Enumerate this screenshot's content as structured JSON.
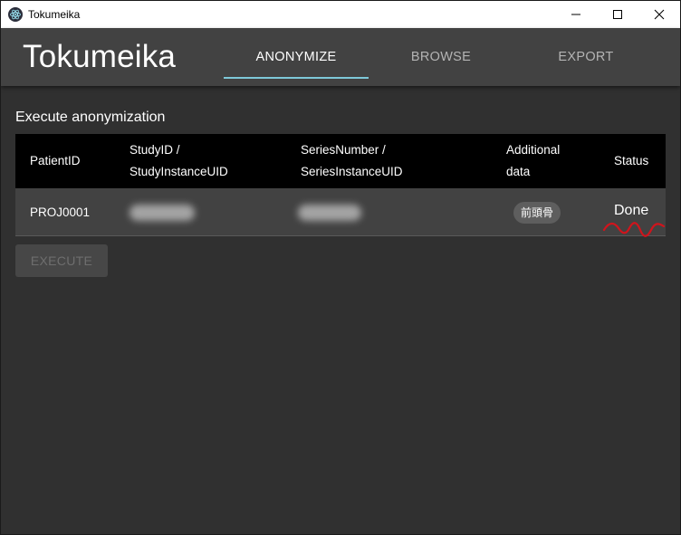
{
  "window": {
    "title": "Tokumeika"
  },
  "appbar": {
    "brand": "Tokumeika",
    "tabs": [
      {
        "label": "ANONYMIZE",
        "active": true
      },
      {
        "label": "BROWSE",
        "active": false
      },
      {
        "label": "EXPORT",
        "active": false
      }
    ],
    "indicator_color": "#7ec8d8"
  },
  "main": {
    "section_title": "Execute anonymization",
    "table": {
      "headers": {
        "patient_id": "PatientID",
        "study_line1": "StudyID /",
        "study_line2": "StudyInstanceUID",
        "series_line1": "SeriesNumber /",
        "series_line2": "SeriesInstanceUID",
        "additional_line1": "Additional",
        "additional_line2": "data",
        "status": "Status"
      },
      "rows": [
        {
          "patient_id": "PROJ0001",
          "study_redacted": true,
          "series_redacted": true,
          "additional_chip": "前頭骨",
          "status": "Done"
        }
      ]
    },
    "execute_label": "EXECUTE",
    "execute_disabled": true
  },
  "icons": {
    "app": "electron-icon",
    "minimize": "minimize-icon",
    "maximize": "maximize-icon",
    "close": "close-icon"
  },
  "colors": {
    "background": "#303030",
    "appbar": "#424242",
    "table_header": "#000000",
    "annotation": "#d0141c"
  }
}
